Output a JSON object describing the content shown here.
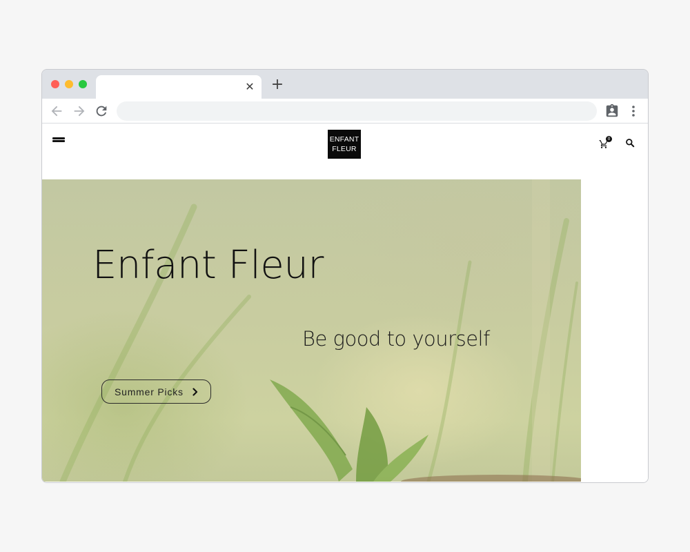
{
  "browser": {
    "tab_title": "",
    "tab_close_icon": "close-icon",
    "new_tab_icon": "plus-icon",
    "address_value": "",
    "address_placeholder": "",
    "icons": [
      "arrow-left-icon",
      "arrow-right-icon",
      "reload-icon",
      "clipboard-account-icon",
      "more-vert-icon"
    ]
  },
  "site": {
    "logo_line1": "ENFANT",
    "logo_line2": "FLEUR",
    "cart_count": "0",
    "icons": [
      "menu-icon",
      "cart-icon",
      "search-icon"
    ]
  },
  "hero": {
    "title": "Enfant Fleur",
    "subtitle": "Be good to yourself",
    "cta_label": "Summer Picks",
    "cta_icon": "chevron-right-icon"
  },
  "colors": {
    "window_frame": "#dee1e6",
    "omnibox": "#f1f3f4",
    "logo_bg": "#0a0a0a",
    "hero_tint": "#c8cca0",
    "leaf_green": "#6f9a3c",
    "traffic_red": "#ff5f57",
    "traffic_yellow": "#febc2e",
    "traffic_green": "#28c840"
  }
}
